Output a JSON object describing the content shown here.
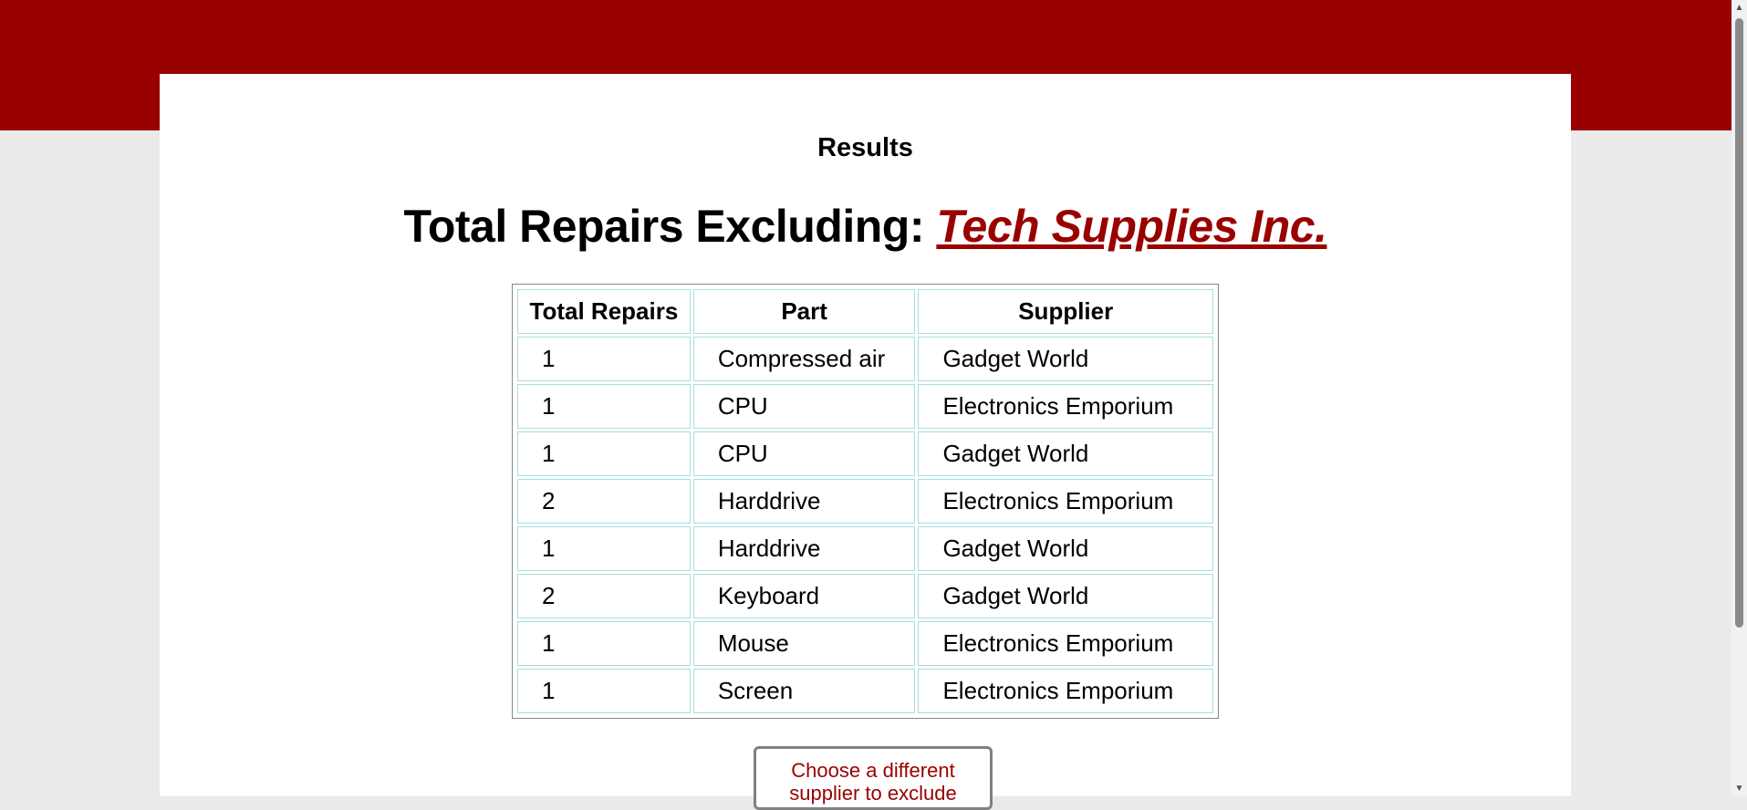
{
  "page": {
    "results_label": "Results",
    "heading_prefix": "Total Repairs Excluding: ",
    "excluded_supplier": "Tech Supplies Inc.",
    "choose_button_label": "Choose a different supplier to exclude"
  },
  "table": {
    "headers": [
      "Total Repairs",
      "Part",
      "Supplier"
    ],
    "rows": [
      [
        "1",
        "Compressed air",
        "Gadget World"
      ],
      [
        "1",
        "CPU",
        "Electronics Emporium"
      ],
      [
        "1",
        "CPU",
        "Gadget World"
      ],
      [
        "2",
        "Harddrive",
        "Electronics Emporium"
      ],
      [
        "1",
        "Harddrive",
        "Gadget World"
      ],
      [
        "2",
        "Keyboard",
        "Gadget World"
      ],
      [
        "1",
        "Mouse",
        "Electronics Emporium"
      ],
      [
        "1",
        "Screen",
        "Electronics Emporium"
      ]
    ]
  },
  "colors": {
    "brand": "#990000",
    "background": "#ebeaeb",
    "card": "#ffffff",
    "cell_border": "#a8dede"
  },
  "icons": {
    "scroll_up": "scroll-up-arrow-icon",
    "scroll_down": "scroll-down-arrow-icon"
  }
}
